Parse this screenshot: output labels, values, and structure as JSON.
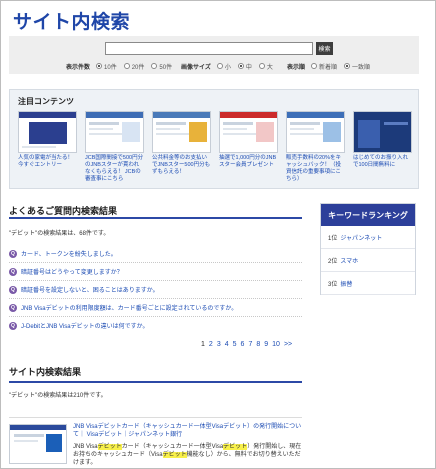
{
  "page": {
    "title": "サイト内検索"
  },
  "search": {
    "input_value": "",
    "button_label": "検索",
    "options": {
      "count_label": "表示件数",
      "count_options": [
        "10件",
        "20件",
        "50件"
      ],
      "count_selected": "10件",
      "image_size_label": "画像サイズ",
      "image_size_options": [
        "小",
        "中",
        "大"
      ],
      "image_size_selected": "中",
      "order_label": "表示順",
      "order_options": [
        "新着順",
        "一致順"
      ],
      "order_selected": "一致順"
    }
  },
  "featured": {
    "title": "注目コンテンツ",
    "items": [
      {
        "caption": "人気の家電が当たる！ 今すぐエントリー",
        "color": "#2b3f8f"
      },
      {
        "caption": "JCB国際間接で500円分のJNBスターが貰われなくもらえる！ JCBの審査事にこちら",
        "color": "#3e6db5"
      },
      {
        "caption": "公共料金等のお支払いでJNBスター500円分もずもらえる！",
        "color": "#4a7ab9"
      },
      {
        "caption": "抽選で1,000円分のJNBスター会員プレゼント",
        "color": "#cc2b2b"
      },
      {
        "caption": "販売手数料の20%をキャッシュバック！（投資信託の重要事項にこちら）",
        "color": "#3d6fb8"
      },
      {
        "caption": "はじめてのお振り入れで100日間無料に",
        "color": "#1c3a7a"
      }
    ]
  },
  "faq": {
    "heading": "よくあるご質問内検索結果",
    "summary": "\"デビット\"の検索結果は、68件です。",
    "items": [
      "カード、トークンを紛失しました。",
      "暗証番号はどうやって変更しますか？",
      "暗証番号を設定しないと、困ることはありますか。",
      "JNB Visaデビットの利用限度額は、カード番号ごとに設定されているのですか。",
      "J-DebitとJNB Visaデビットの違いは何ですか。"
    ],
    "pager": [
      "1",
      "2",
      "3",
      "4",
      "5",
      "6",
      "7",
      "8",
      "9",
      "10",
      ">>"
    ]
  },
  "ranking": {
    "heading": "キーワードランキング",
    "items": [
      {
        "rank": "1位",
        "keyword": "ジャパンネット"
      },
      {
        "rank": "2位",
        "keyword": "スマホ"
      },
      {
        "rank": "3位",
        "keyword": "振替"
      }
    ]
  },
  "site_results": {
    "heading": "サイト内検索結果",
    "summary": "\"デビット\"の検索結果は210件です。",
    "result": {
      "title": "JNB Visaデビットカード（キャッシュカード一体型Visaデビット）の発行開始について｜ Visaデビット｜ジャパンネット銀行",
      "desc_pre": "JNB Visa",
      "desc_hl1": "デビット",
      "desc_mid": "カード（キャッシュカード一体型Visa",
      "desc_hl2": "デビット",
      "desc_mid2": "）発行開始し、現在お持ちのキャッシュカード（Visa",
      "desc_hl3": "デビット",
      "desc_post": "機能なし）から、無料でお切り替えいただけます。"
    }
  }
}
